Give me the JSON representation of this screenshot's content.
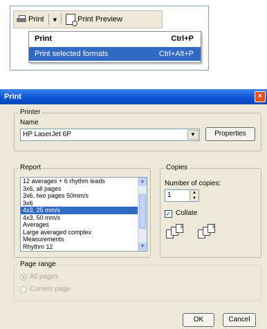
{
  "toolbar": {
    "print_label": "Print",
    "dropdown_arrow": "▾",
    "preview_label": "Print Preview"
  },
  "menu": {
    "items": [
      {
        "label": "Print",
        "shortcut": "Ctrl+P"
      },
      {
        "label": "Print selected formats",
        "shortcut": "Ctrl+Alt+P"
      }
    ]
  },
  "dialog": {
    "title": "Print",
    "close": "×",
    "printer": {
      "legend": "Printer",
      "name_label": "Name",
      "name_value": "HP LaserJet 6P",
      "properties_label": "Properties"
    },
    "report": {
      "legend": "Report",
      "items": [
        "12 averages + 6 rhythm leads",
        "3x6, all pages",
        "3x6, two pages 50mm/s",
        "3x6",
        "4x3, 25 mm/s",
        "4x3, 50 mm/s",
        "Averages",
        "Large averaged complex",
        "Measurements",
        "Rhythm 12"
      ],
      "selected_index": 4
    },
    "copies": {
      "legend": "Copies",
      "number_label": "Number of copies:",
      "number_value": "1",
      "collate_label": "Collate",
      "collate_checked": true
    },
    "page_range": {
      "legend": "Page range",
      "all_pages": "All pages",
      "current_page": "Current page"
    },
    "ok_label": "OK",
    "cancel_label": "Cancel"
  },
  "colors": {
    "selection": "#316ac5",
    "dialog_bg": "#ece9d8",
    "titlebar": "#0b52d4"
  }
}
